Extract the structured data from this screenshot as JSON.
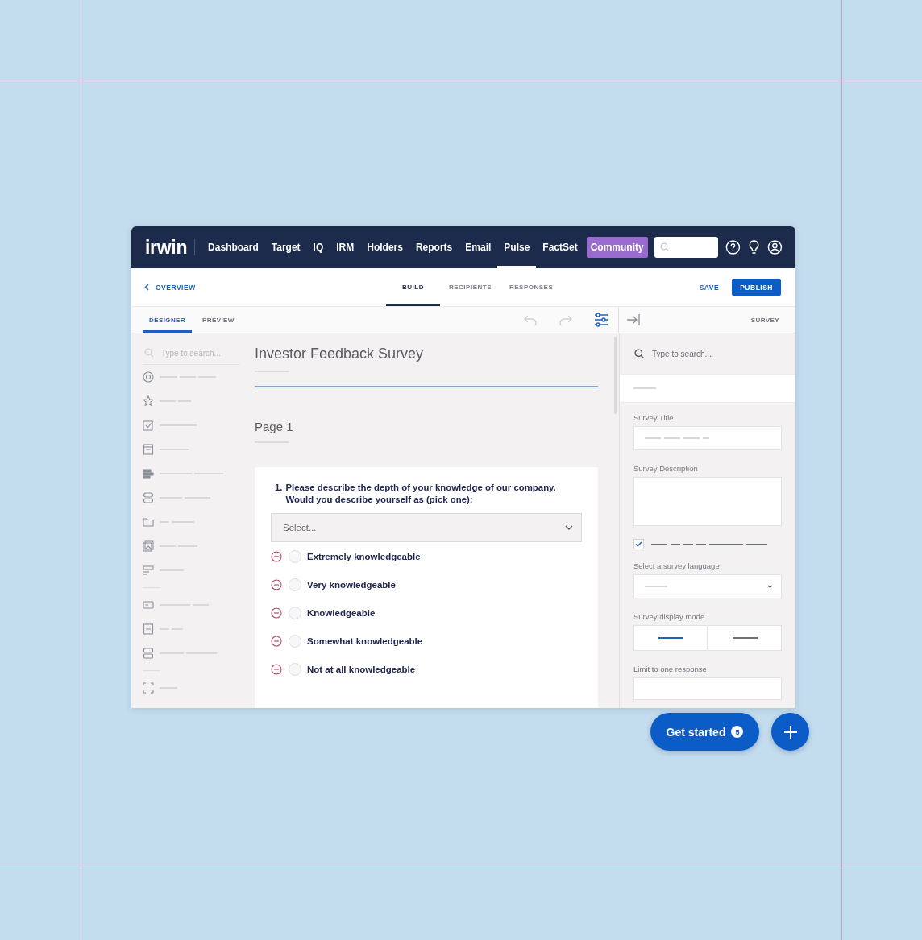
{
  "app": {
    "logo": "irwin"
  },
  "nav": [
    {
      "label": "Dashboard",
      "selected": false,
      "kind": "link"
    },
    {
      "label": "Target",
      "selected": false,
      "kind": "link"
    },
    {
      "label": "IQ",
      "selected": false,
      "kind": "link"
    },
    {
      "label": "IRM",
      "selected": false,
      "kind": "link"
    },
    {
      "label": "Holders",
      "selected": false,
      "kind": "link"
    },
    {
      "label": "Reports",
      "selected": false,
      "kind": "link"
    },
    {
      "label": "Email",
      "selected": false,
      "kind": "link"
    },
    {
      "label": "Pulse",
      "selected": true,
      "kind": "link"
    },
    {
      "label": "FactSet",
      "selected": false,
      "kind": "link"
    },
    {
      "label": "Community",
      "selected": false,
      "kind": "highlight"
    }
  ],
  "back_link": "OVERVIEW",
  "tabs": [
    {
      "label": "BUILD",
      "selected": true
    },
    {
      "label": "RECIPIENTS",
      "selected": false
    },
    {
      "label": "RESPONSES",
      "selected": false
    }
  ],
  "actions": {
    "save": "SAVE",
    "publish": "PUBLISH"
  },
  "view_tabs": [
    {
      "label": "DESIGNER",
      "selected": true
    },
    {
      "label": "PREVIEW",
      "selected": false
    }
  ],
  "panel_title": "SURVEY",
  "sidebar": {
    "search_placeholder": "Type to search..."
  },
  "survey": {
    "title": "Investor Feedback Survey",
    "page": "Page 1",
    "question": {
      "number": "1.",
      "text": "Please describe the depth of your knowledge of our company. Would you describe yourself as (pick one):",
      "select_placeholder": "Select...",
      "options": [
        {
          "label": "Extremely knowledgeable",
          "selected": false
        },
        {
          "label": "Very knowledgeable",
          "selected": false
        },
        {
          "label": "Knowledgeable",
          "selected": false
        },
        {
          "label": "Somewhat knowledgeable",
          "selected": false
        },
        {
          "label": "Not at all knowledgeable",
          "selected": false
        }
      ]
    }
  },
  "properties": {
    "search_placeholder": "Type to search...",
    "title_label": "Survey Title",
    "description_label": "Survey Description",
    "option_checked": true,
    "language_label": "Select a survey language",
    "display_mode_label": "Survey display mode",
    "display_modes": [
      {
        "selected": true
      },
      {
        "selected": false
      }
    ],
    "limit_label": "Limit to one response"
  },
  "get_started": {
    "label": "Get started",
    "count": "5"
  }
}
